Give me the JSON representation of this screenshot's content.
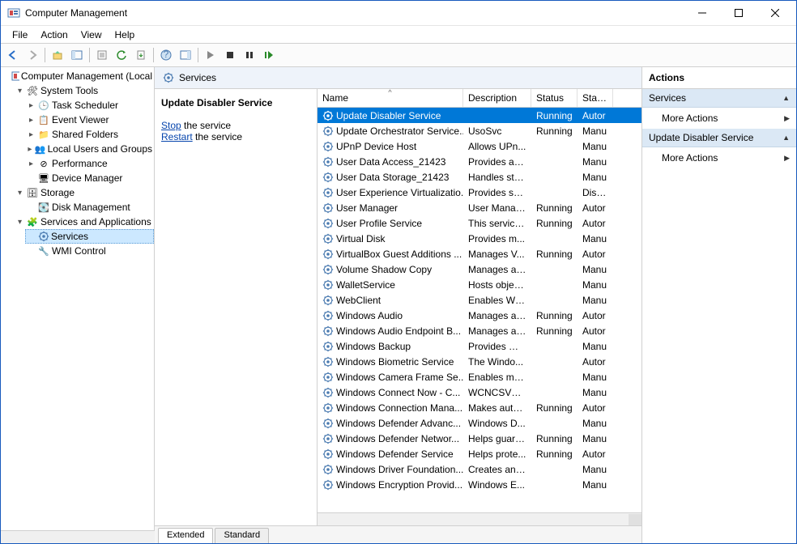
{
  "window": {
    "title": "Computer Management"
  },
  "menu": {
    "file": "File",
    "action": "Action",
    "view": "View",
    "help": "Help"
  },
  "tree": {
    "root": "Computer Management (Local",
    "systemTools": "System Tools",
    "taskScheduler": "Task Scheduler",
    "eventViewer": "Event Viewer",
    "sharedFolders": "Shared Folders",
    "localUsers": "Local Users and Groups",
    "performance": "Performance",
    "deviceManager": "Device Manager",
    "storage": "Storage",
    "diskManagement": "Disk Management",
    "servicesApps": "Services and Applications",
    "services": "Services",
    "wmi": "WMI Control"
  },
  "center": {
    "title": "Services",
    "detailTitle": "Update Disabler Service",
    "stop": "Stop",
    "stopRest": " the service",
    "restart": "Restart",
    "restartRest": " the service"
  },
  "columns": {
    "name": "Name",
    "description": "Description",
    "status": "Status",
    "startup": "Startu"
  },
  "tabs": {
    "extended": "Extended",
    "standard": "Standard"
  },
  "actions": {
    "header": "Actions",
    "group1": "Services",
    "group2": "Update Disabler Service",
    "more": "More Actions"
  },
  "services": [
    {
      "name": "Update Disabler Service",
      "desc": "",
      "status": "Running",
      "start": "Autor",
      "selected": true
    },
    {
      "name": "Update Orchestrator Service...",
      "desc": "UsoSvc",
      "status": "Running",
      "start": "Manu"
    },
    {
      "name": "UPnP Device Host",
      "desc": "Allows UPn...",
      "status": "",
      "start": "Manu"
    },
    {
      "name": "User Data Access_21423",
      "desc": "Provides ap...",
      "status": "",
      "start": "Manu"
    },
    {
      "name": "User Data Storage_21423",
      "desc": "Handles sto...",
      "status": "",
      "start": "Manu"
    },
    {
      "name": "User Experience Virtualizatio...",
      "desc": "Provides su...",
      "status": "",
      "start": "Disabl"
    },
    {
      "name": "User Manager",
      "desc": "User Manag...",
      "status": "Running",
      "start": "Autor"
    },
    {
      "name": "User Profile Service",
      "desc": "This service ...",
      "status": "Running",
      "start": "Autor"
    },
    {
      "name": "Virtual Disk",
      "desc": "Provides m...",
      "status": "",
      "start": "Manu"
    },
    {
      "name": "VirtualBox Guest Additions ...",
      "desc": "Manages V...",
      "status": "Running",
      "start": "Autor"
    },
    {
      "name": "Volume Shadow Copy",
      "desc": "Manages an...",
      "status": "",
      "start": "Manu"
    },
    {
      "name": "WalletService",
      "desc": "Hosts objec...",
      "status": "",
      "start": "Manu"
    },
    {
      "name": "WebClient",
      "desc": "Enables Win...",
      "status": "",
      "start": "Manu"
    },
    {
      "name": "Windows Audio",
      "desc": "Manages au...",
      "status": "Running",
      "start": "Autor"
    },
    {
      "name": "Windows Audio Endpoint B...",
      "desc": "Manages au...",
      "status": "Running",
      "start": "Autor"
    },
    {
      "name": "Windows Backup",
      "desc": "Provides Wi...",
      "status": "",
      "start": "Manu"
    },
    {
      "name": "Windows Biometric Service",
      "desc": "The Windo...",
      "status": "",
      "start": "Autor"
    },
    {
      "name": "Windows Camera Frame Se...",
      "desc": "Enables mul...",
      "status": "",
      "start": "Manu"
    },
    {
      "name": "Windows Connect Now - C...",
      "desc": "WCNCSVC ...",
      "status": "",
      "start": "Manu"
    },
    {
      "name": "Windows Connection Mana...",
      "desc": "Makes auto...",
      "status": "Running",
      "start": "Autor"
    },
    {
      "name": "Windows Defender Advanc...",
      "desc": "Windows D...",
      "status": "",
      "start": "Manu"
    },
    {
      "name": "Windows Defender Networ...",
      "desc": "Helps guard...",
      "status": "Running",
      "start": "Manu"
    },
    {
      "name": "Windows Defender Service",
      "desc": "Helps prote...",
      "status": "Running",
      "start": "Autor"
    },
    {
      "name": "Windows Driver Foundation...",
      "desc": "Creates and...",
      "status": "",
      "start": "Manu"
    },
    {
      "name": "Windows Encryption Provid...",
      "desc": "Windows E...",
      "status": "",
      "start": "Manu"
    }
  ]
}
